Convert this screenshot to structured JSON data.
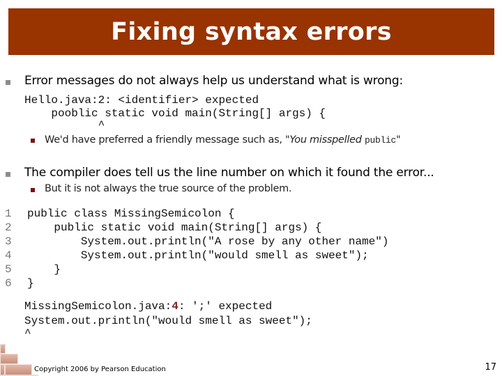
{
  "slide": {
    "title": "Fixing syntax errors",
    "page_number": "17",
    "footer": "Copyright 2006 by Pearson Education",
    "colors": {
      "title_bar": "#993300",
      "title_text": "#ffffff",
      "bullet_level1": "#8c8c8c",
      "bullet_level2": "#7a1010",
      "highlight": "#7f1f1f"
    }
  },
  "bullets": [
    {
      "text": "Error messages do not always help us understand what is wrong:",
      "code": [
        "Hello.java:2: <identifier> expected",
        "    pooblic static void main(String[] args) {",
        "           ^"
      ],
      "sub": {
        "prefix": "We'd have preferred a friendly message such as, \"",
        "italic": "You misspelled ",
        "code_word": "public",
        "suffix": "\""
      }
    },
    {
      "text": "The compiler does tell us the line number on which it found the error...",
      "sub": {
        "text": "But it is not always the true source of the problem."
      }
    }
  ],
  "code_listing": {
    "line_numbers": [
      "1",
      "2",
      "3",
      "4",
      "5",
      "6"
    ],
    "lines": [
      "public class MissingSemicolon {",
      "    public static void main(String[] args) {",
      "        System.out.println(\"A rose by any other name\")",
      "        System.out.println(\"would smell as sweet\");",
      "    }",
      "}"
    ]
  },
  "error_output": {
    "file_prefix": "MissingSemicolon.java:",
    "line_number": "4",
    "message": ": ';' expected",
    "source_line": "System.out.println(\"would smell as sweet\");",
    "caret": "^"
  }
}
